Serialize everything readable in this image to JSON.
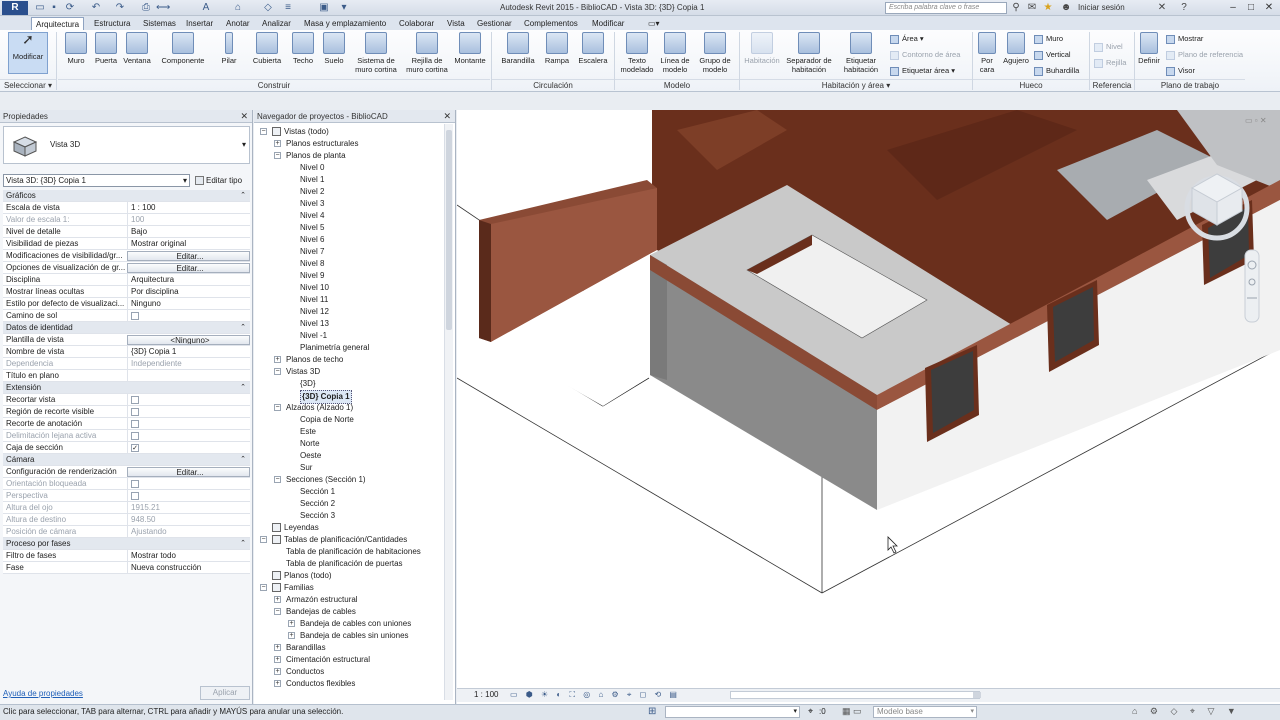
{
  "titlebar": {
    "logo": "R",
    "title": "Autodesk Revit 2015  -  BiblioCAD - Vista 3D: {3D} Copia 1",
    "search_placeholder": "Escriba palabra clave o frase",
    "signin": "Iniciar sesión"
  },
  "tabs": [
    "Arquitectura",
    "Estructura",
    "Sistemas",
    "Insertar",
    "Anotar",
    "Analizar",
    "Masa y emplazamiento",
    "Colaborar",
    "Vista",
    "Gestionar",
    "Complementos",
    "Modificar"
  ],
  "ribbon": {
    "modificar": "Modificar",
    "seleccionar": "Seleccionar",
    "construir": {
      "label": "Construir",
      "buttons": [
        "Muro",
        "Puerta",
        "Ventana",
        "Componente",
        "Pilar",
        "Cubierta",
        "Techo",
        "Suelo",
        "Sistema de muro cortina",
        "Rejilla de muro cortina",
        "Montante"
      ]
    },
    "circulacion": {
      "label": "Circulación",
      "buttons": [
        "Barandilla",
        "Rampa",
        "Escalera"
      ]
    },
    "modelo": {
      "label": "Modelo",
      "buttons": [
        "Texto modelado",
        "Línea de modelo",
        "Grupo de modelo"
      ]
    },
    "habitacion": {
      "label": "Habitación y área",
      "buttons": [
        "Habitación",
        "Separador de habitación",
        "Etiquetar habitación"
      ],
      "small": [
        "Área",
        "Contorno de área",
        "Etiquetar  área"
      ]
    },
    "hueco": {
      "label": "Hueco",
      "buttons": [
        "Por cara",
        "Agujero"
      ],
      "small": [
        "Muro",
        "Vertical",
        "Buhardilla"
      ]
    },
    "referencia": {
      "label": "Referencia",
      "small": [
        "Nivel",
        "Rejilla"
      ]
    },
    "plano_trabajo": {
      "label": "Plano de trabajo",
      "buttons": [
        "Definir"
      ],
      "small": [
        "Mostrar",
        "Plano de referencia",
        "Visor"
      ]
    }
  },
  "properties": {
    "header": "Propiedades",
    "type_name": "Vista 3D",
    "instance": "Vista 3D: {3D} Copia 1",
    "edit_type": "Editar tipo",
    "rows": [
      {
        "kind": "sec",
        "label": "Gráficos"
      },
      {
        "label": "Escala de vista",
        "value": "1 : 100"
      },
      {
        "label": "Valor de escala    1:",
        "value": "100",
        "dim": true
      },
      {
        "label": "Nivel de detalle",
        "value": "Bajo"
      },
      {
        "label": "Visibilidad de piezas",
        "value": "Mostrar original"
      },
      {
        "label": "Modificaciones de visibilidad/gr...",
        "value": "Editar...",
        "btn": true
      },
      {
        "label": "Opciones de visualización de gr...",
        "value": "Editar...",
        "btn": true
      },
      {
        "label": "Disciplina",
        "value": "Arquitectura"
      },
      {
        "label": "Mostrar líneas ocultas",
        "value": "Por disciplina"
      },
      {
        "label": "Estilo por defecto de visualizaci...",
        "value": "Ninguno"
      },
      {
        "label": "Camino de sol",
        "value": "",
        "check": ""
      },
      {
        "kind": "sec",
        "label": "Datos de identidad"
      },
      {
        "label": "Plantilla de vista",
        "value": "<Ninguno>",
        "btn": true
      },
      {
        "label": "Nombre de vista",
        "value": "{3D} Copia 1"
      },
      {
        "label": "Dependencia",
        "value": "Independiente",
        "dim": true
      },
      {
        "label": "Título en plano",
        "value": ""
      },
      {
        "kind": "sec",
        "label": "Extensión"
      },
      {
        "label": "Recortar vista",
        "value": "",
        "check": ""
      },
      {
        "label": "Región de recorte visible",
        "value": "",
        "check": ""
      },
      {
        "label": "Recorte de anotación",
        "value": "",
        "check": ""
      },
      {
        "label": "Delimitación lejana activa",
        "value": "",
        "check": "",
        "dim": true
      },
      {
        "label": "Caja de sección",
        "value": "",
        "check": "✓"
      },
      {
        "kind": "sec",
        "label": "Cámara"
      },
      {
        "label": "Configuración de renderización",
        "value": "Editar...",
        "btn": true
      },
      {
        "label": "Orientación bloqueada",
        "value": "",
        "check": "",
        "dim": true
      },
      {
        "label": "Perspectiva",
        "value": "",
        "check": "",
        "dim": true
      },
      {
        "label": "Altura del ojo",
        "value": "1915.21",
        "dim": true
      },
      {
        "label": "Altura de destino",
        "value": "948.50",
        "dim": true
      },
      {
        "label": "Posición de cámara",
        "value": "Ajustando",
        "dim": true
      },
      {
        "kind": "sec",
        "label": "Proceso por fases"
      },
      {
        "label": "Filtro de fases",
        "value": "Mostrar todo"
      },
      {
        "label": "Fase",
        "value": "Nueva construcción"
      }
    ],
    "help": "Ayuda de propiedades",
    "apply": "Aplicar"
  },
  "navigator": {
    "header": "Navegador de proyectos - BiblioCAD",
    "items": [
      {
        "text": "Vistas (todo)",
        "lvl": 0,
        "exp": "−",
        "icon": true
      },
      {
        "text": "Planos estructurales",
        "lvl": 1,
        "exp": "+"
      },
      {
        "text": "Planos de planta",
        "lvl": 1,
        "exp": "−"
      },
      {
        "text": "Nivel 0",
        "lvl": 2
      },
      {
        "text": "Nivel 1",
        "lvl": 2
      },
      {
        "text": "Nivel 2",
        "lvl": 2
      },
      {
        "text": "Nivel 3",
        "lvl": 2
      },
      {
        "text": "Nivel 4",
        "lvl": 2
      },
      {
        "text": "Nivel 5",
        "lvl": 2
      },
      {
        "text": "Nivel 6",
        "lvl": 2
      },
      {
        "text": "Nivel 7",
        "lvl": 2
      },
      {
        "text": "Nivel 8",
        "lvl": 2
      },
      {
        "text": "Nivel 9",
        "lvl": 2
      },
      {
        "text": "Nivel 10",
        "lvl": 2
      },
      {
        "text": "Nivel 11",
        "lvl": 2
      },
      {
        "text": "Nivel 12",
        "lvl": 2
      },
      {
        "text": "Nivel 13",
        "lvl": 2
      },
      {
        "text": "Nivel -1",
        "lvl": 2
      },
      {
        "text": "Planimetría general",
        "lvl": 2
      },
      {
        "text": "Planos de techo",
        "lvl": 1,
        "exp": "+"
      },
      {
        "text": "Vistas 3D",
        "lvl": 1,
        "exp": "−"
      },
      {
        "text": "{3D}",
        "lvl": 2
      },
      {
        "text": "{3D} Copia 1",
        "lvl": 2,
        "sel": true
      },
      {
        "text": "Alzados (Alzado 1)",
        "lvl": 1,
        "exp": "−"
      },
      {
        "text": "Copia de Norte",
        "lvl": 2
      },
      {
        "text": "Este",
        "lvl": 2
      },
      {
        "text": "Norte",
        "lvl": 2
      },
      {
        "text": "Oeste",
        "lvl": 2
      },
      {
        "text": "Sur",
        "lvl": 2
      },
      {
        "text": "Secciones (Sección  1)",
        "lvl": 1,
        "exp": "−"
      },
      {
        "text": "Sección 1",
        "lvl": 2
      },
      {
        "text": "Sección 2",
        "lvl": 2
      },
      {
        "text": "Sección 3",
        "lvl": 2
      },
      {
        "text": "Leyendas",
        "lvl": 0,
        "icon": true
      },
      {
        "text": "Tablas de planificación/Cantidades",
        "lvl": 0,
        "exp": "−",
        "icon": true
      },
      {
        "text": "Tabla de planificación de habitaciones",
        "lvl": 1
      },
      {
        "text": "Tabla de planificación de puertas",
        "lvl": 1
      },
      {
        "text": "Planos (todo)",
        "lvl": 0,
        "icon": true
      },
      {
        "text": "Familias",
        "lvl": 0,
        "exp": "−",
        "icon": true
      },
      {
        "text": "Armazón estructural",
        "lvl": 1,
        "exp": "+"
      },
      {
        "text": "Bandejas de cables",
        "lvl": 1,
        "exp": "−"
      },
      {
        "text": "Bandeja de cables con uniones",
        "lvl": 2,
        "exp": "+"
      },
      {
        "text": "Bandeja de cables sin uniones",
        "lvl": 2,
        "exp": "+"
      },
      {
        "text": "Barandillas",
        "lvl": 1,
        "exp": "+"
      },
      {
        "text": "Cimentación estructural",
        "lvl": 1,
        "exp": "+"
      },
      {
        "text": "Conductos",
        "lvl": 1,
        "exp": "+"
      },
      {
        "text": "Conductos flexibles",
        "lvl": 1,
        "exp": "+"
      }
    ]
  },
  "viewport": {
    "scale": "1 : 100"
  },
  "status": {
    "text": "Clic para seleccionar, TAB para alternar, CTRL para añadir y MAYÚS para anular una selección.",
    "zero": ":0",
    "model": "Modelo base"
  }
}
